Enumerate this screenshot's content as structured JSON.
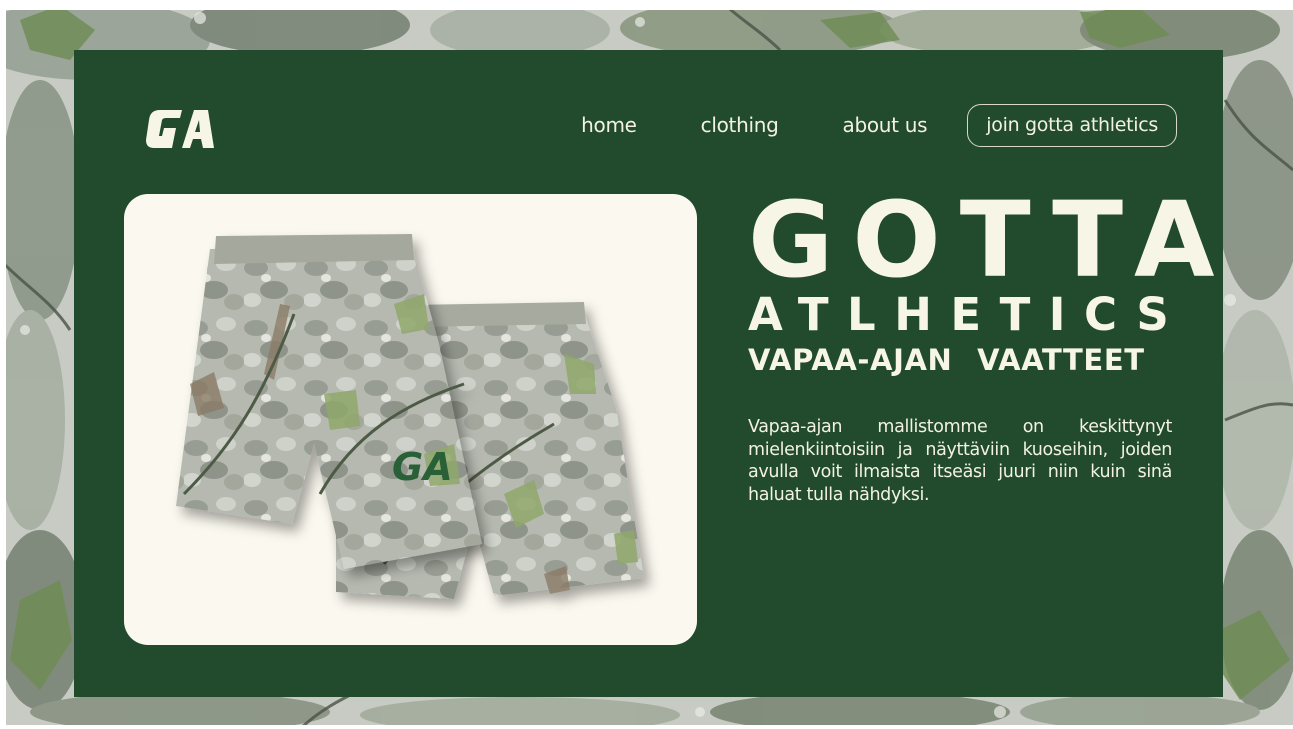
{
  "brand": {
    "logo_text": "GA"
  },
  "nav": {
    "items": [
      "home",
      "clothing",
      "about us"
    ],
    "join_label": "join gotta athletics"
  },
  "hero": {
    "title": "GOTTA",
    "subtitle": "ATLHETICS",
    "tagline": "VAPAA-AJAN VAATTEET",
    "body": "Vapaa-ajan mallistomme on keskittynyt mielenkiintoisiin ja näyttäviin kuoseihin, joiden avulla voit ilmaista itseäsi juuri niin kuin sinä haluat tulla nähdyksi."
  },
  "product": {
    "shorts_logo_text": "GA"
  },
  "colors": {
    "panel_green": "#214b2c",
    "card_cream": "#fbf9ef",
    "text_cream": "#f7f5e6",
    "camo_base": "#c9ccc5"
  },
  "icons": {
    "logo": "ga-logo-icon"
  }
}
